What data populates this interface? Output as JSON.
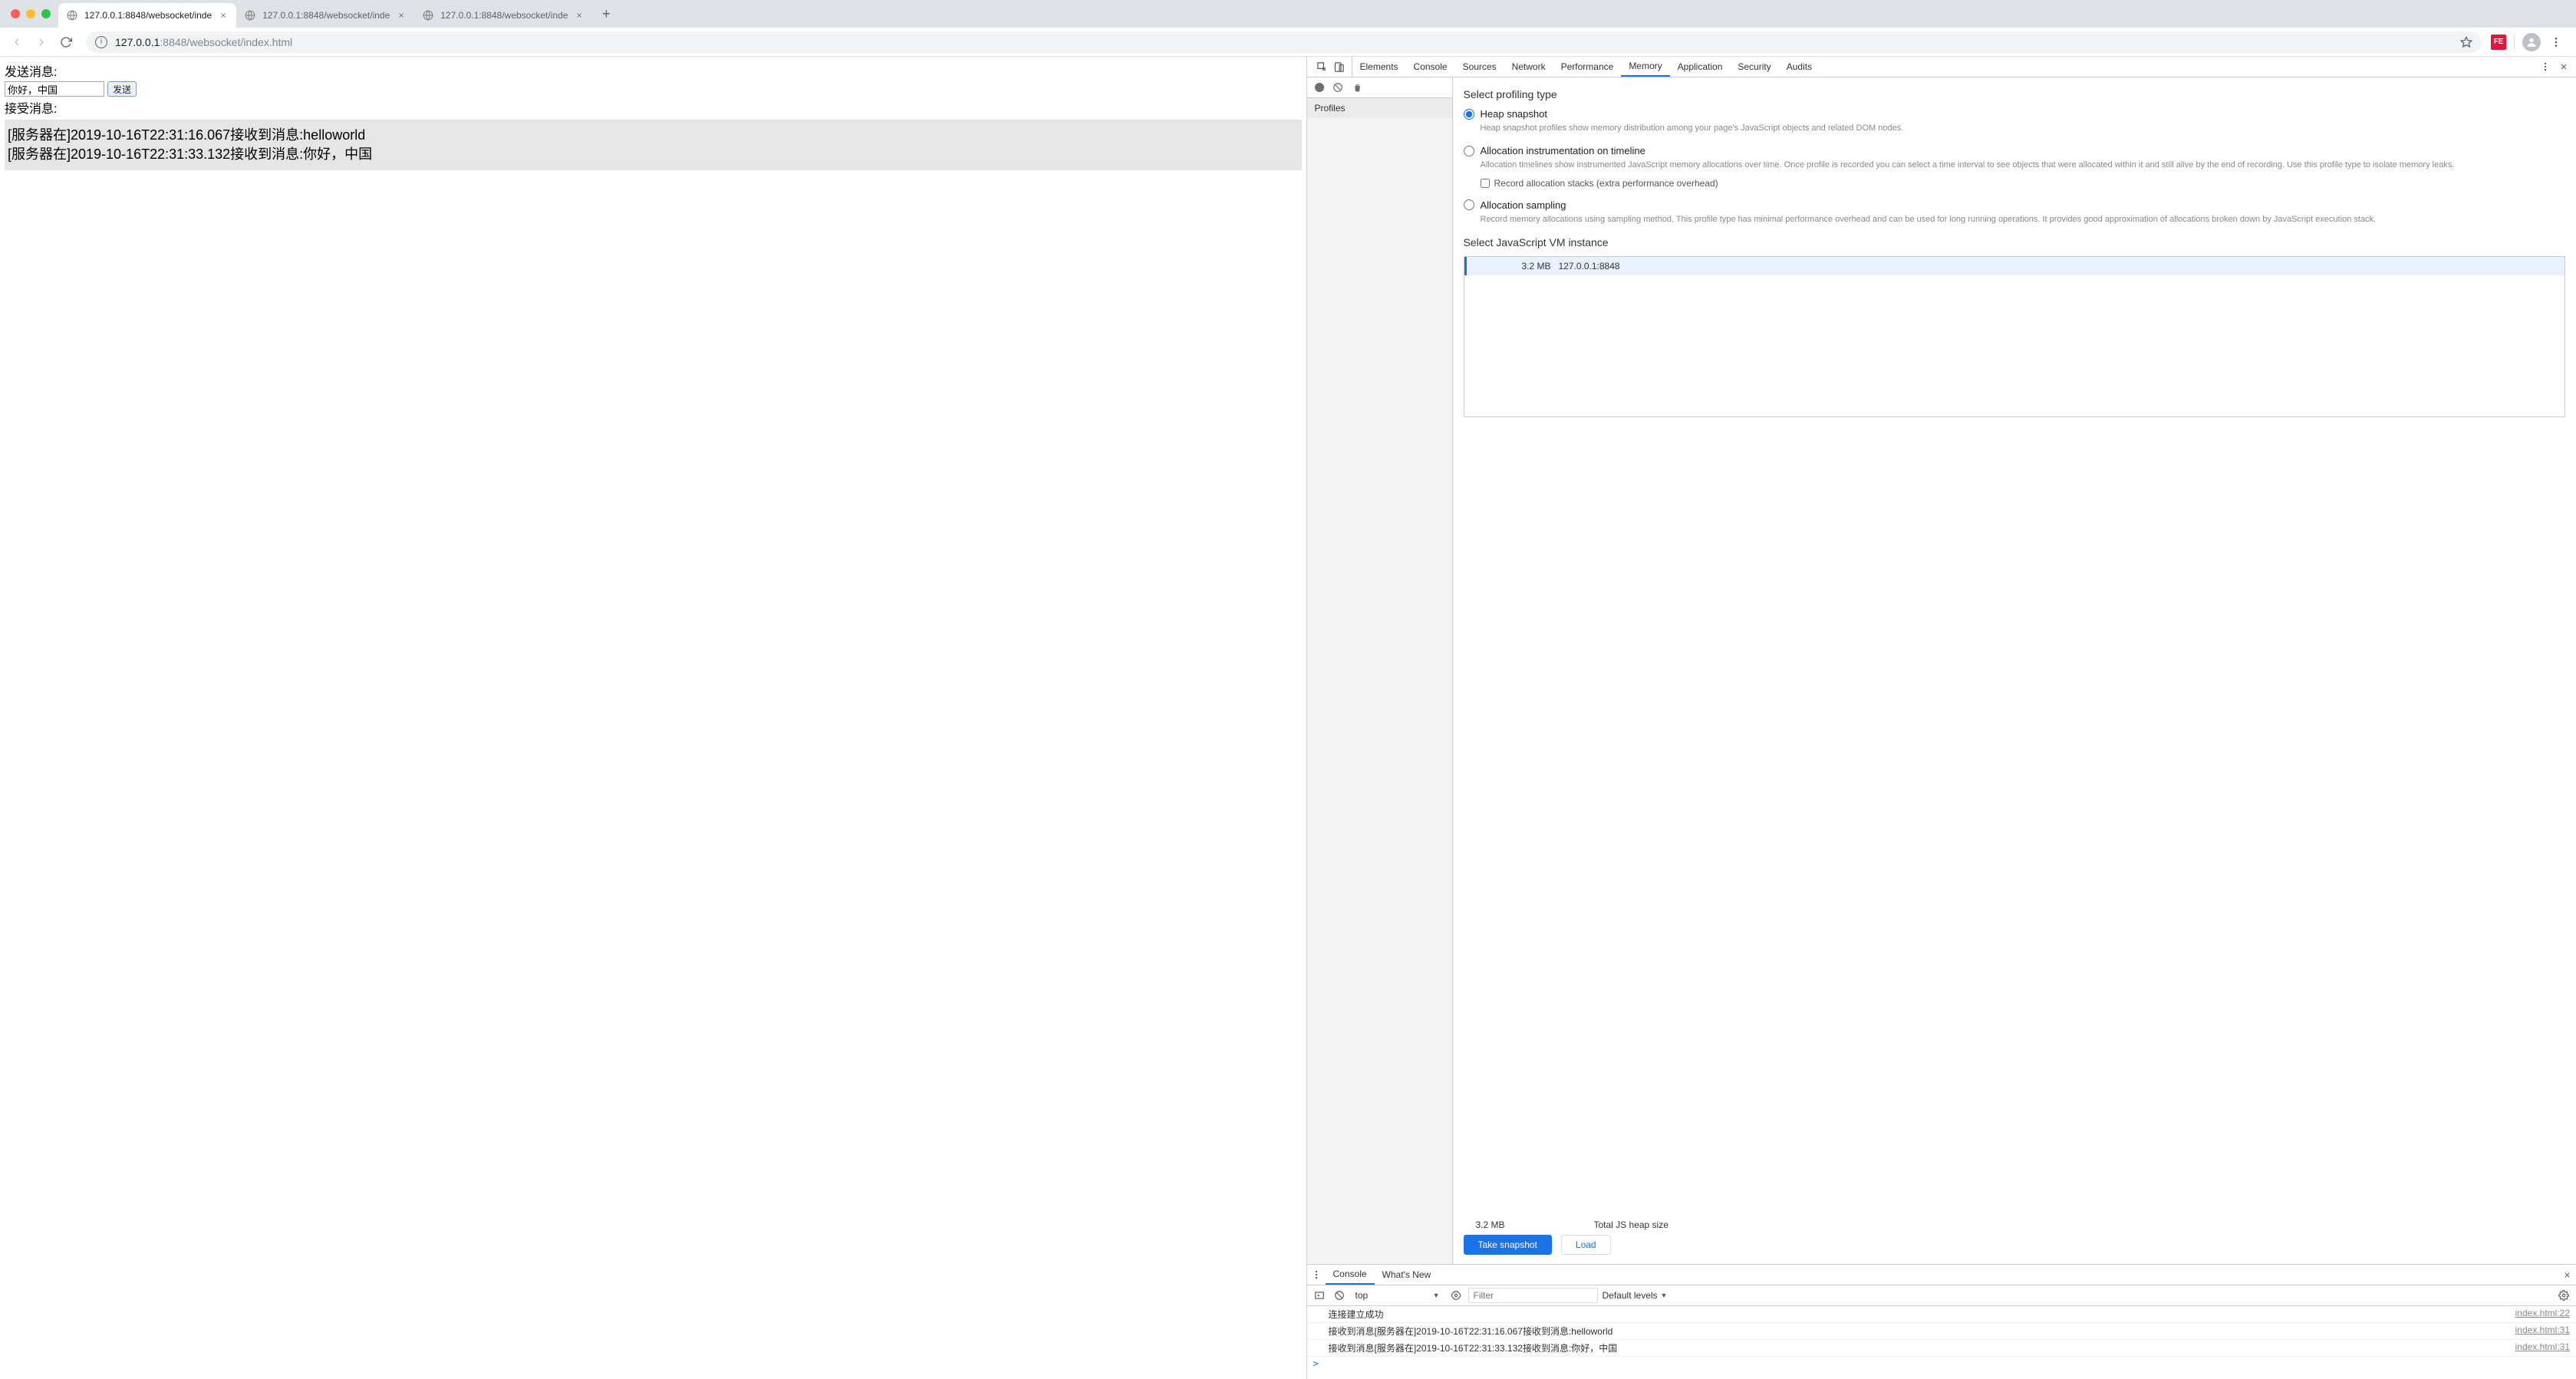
{
  "browser": {
    "tabs": [
      {
        "title": "127.0.0.1:8848/websocket/inde",
        "active": true
      },
      {
        "title": "127.0.0.1:8848/websocket/inde",
        "active": false
      },
      {
        "title": "127.0.0.1:8848/websocket/inde",
        "active": false
      }
    ],
    "url_host": "127.0.0.1",
    "url_rest": ":8848/websocket/index.html",
    "ext_badge": "FE"
  },
  "page": {
    "send_label": "发送消息:",
    "input_value": "你好，中国",
    "send_button": "发送",
    "recv_label": "接受消息:",
    "messages": [
      "[服务器在]2019-10-16T22:31:16.067接收到消息:helloworld",
      "[服务器在]2019-10-16T22:31:33.132接收到消息:你好，中国"
    ]
  },
  "devtools": {
    "tabs": [
      "Elements",
      "Console",
      "Sources",
      "Network",
      "Performance",
      "Memory",
      "Application",
      "Security",
      "Audits"
    ],
    "active_tab": "Memory",
    "sidebar_section": "Profiles",
    "heading1": "Select profiling type",
    "options": [
      {
        "title": "Heap snapshot",
        "desc": "Heap snapshot profiles show memory distribution among your page's JavaScript objects and related DOM nodes.",
        "checked": true
      },
      {
        "title": "Allocation instrumentation on timeline",
        "desc": "Allocation timelines show instrumented JavaScript memory allocations over time. Once profile is recorded you can select a time interval to see objects that were allocated within it and still alive by the end of recording. Use this profile type to isolate memory leaks.",
        "checked": false,
        "checkbox": "Record allocation stacks (extra performance overhead)"
      },
      {
        "title": "Allocation sampling",
        "desc": "Record memory allocations using sampling method. This profile type has minimal performance overhead and can be used for long running operations. It provides good approximation of allocations broken down by JavaScript execution stack.",
        "checked": false
      }
    ],
    "heading2": "Select JavaScript VM instance",
    "vm": {
      "size": "3.2 MB",
      "name": "127.0.0.1:8848"
    },
    "stats": {
      "size": "3.2 MB",
      "label": "Total JS heap size"
    },
    "take_snapshot": "Take snapshot",
    "load": "Load"
  },
  "drawer": {
    "tabs": [
      "Console",
      "What's New"
    ],
    "active": "Console",
    "context": "top",
    "filter_placeholder": "Filter",
    "levels": "Default levels",
    "logs": [
      {
        "msg": "连接建立成功",
        "src": "index.html:22"
      },
      {
        "msg": "接收到消息[服务器在]2019-10-16T22:31:16.067接收到消息:helloworld",
        "src": "index.html:31"
      },
      {
        "msg": "接收到消息[服务器在]2019-10-16T22:31:33.132接收到消息:你好，中国",
        "src": "index.html:31"
      }
    ],
    "prompt": ">"
  }
}
